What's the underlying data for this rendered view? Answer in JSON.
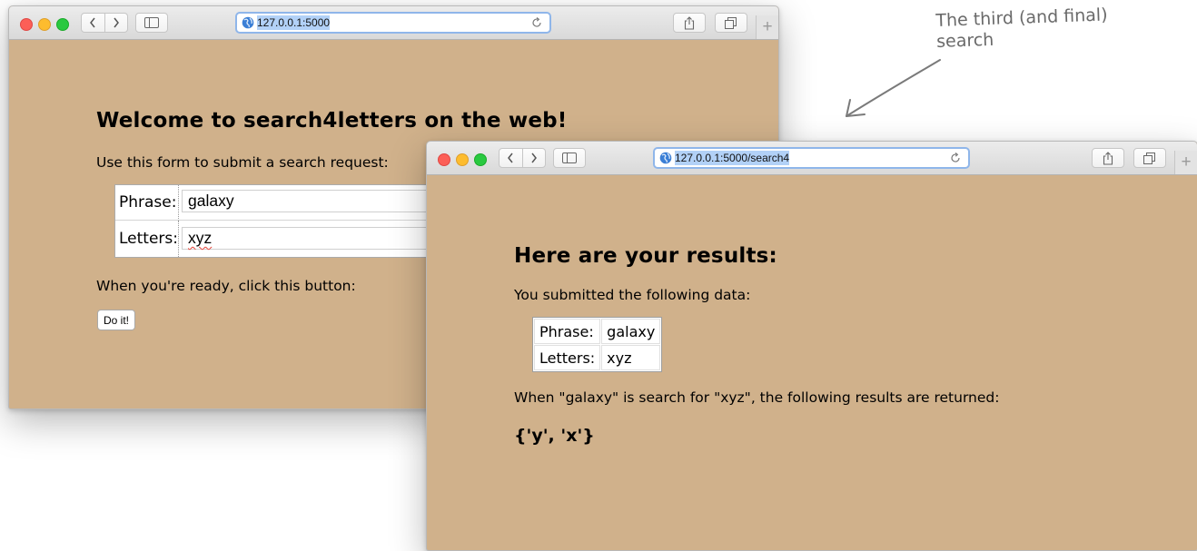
{
  "annotation": {
    "line1": "The third (and final)",
    "line2": "search"
  },
  "window_form": {
    "url": "127.0.0.1:5000",
    "heading": "Welcome to search4letters on the web!",
    "intro": "Use this form to submit a search request:",
    "fields": [
      {
        "label": "Phrase:",
        "value": "galaxy"
      },
      {
        "label": "Letters:",
        "value": "xyz"
      }
    ],
    "ready_text": "When you're ready, click this button:",
    "button_label": "Do it!"
  },
  "window_results": {
    "url": "127.0.0.1:5000/search4",
    "heading": "Here are your results:",
    "submitted_text": "You submitted the following data:",
    "rows": [
      {
        "label": "Phrase:",
        "value": "galaxy"
      },
      {
        "label": "Letters:",
        "value": "xyz"
      }
    ],
    "result_intro": "When \"galaxy\" is search for \"xyz\", the following results are returned:",
    "result": "{'y', 'x'}"
  },
  "colors": {
    "page_bg": "#d0b18b",
    "url_highlight": "#b2d1f7"
  }
}
